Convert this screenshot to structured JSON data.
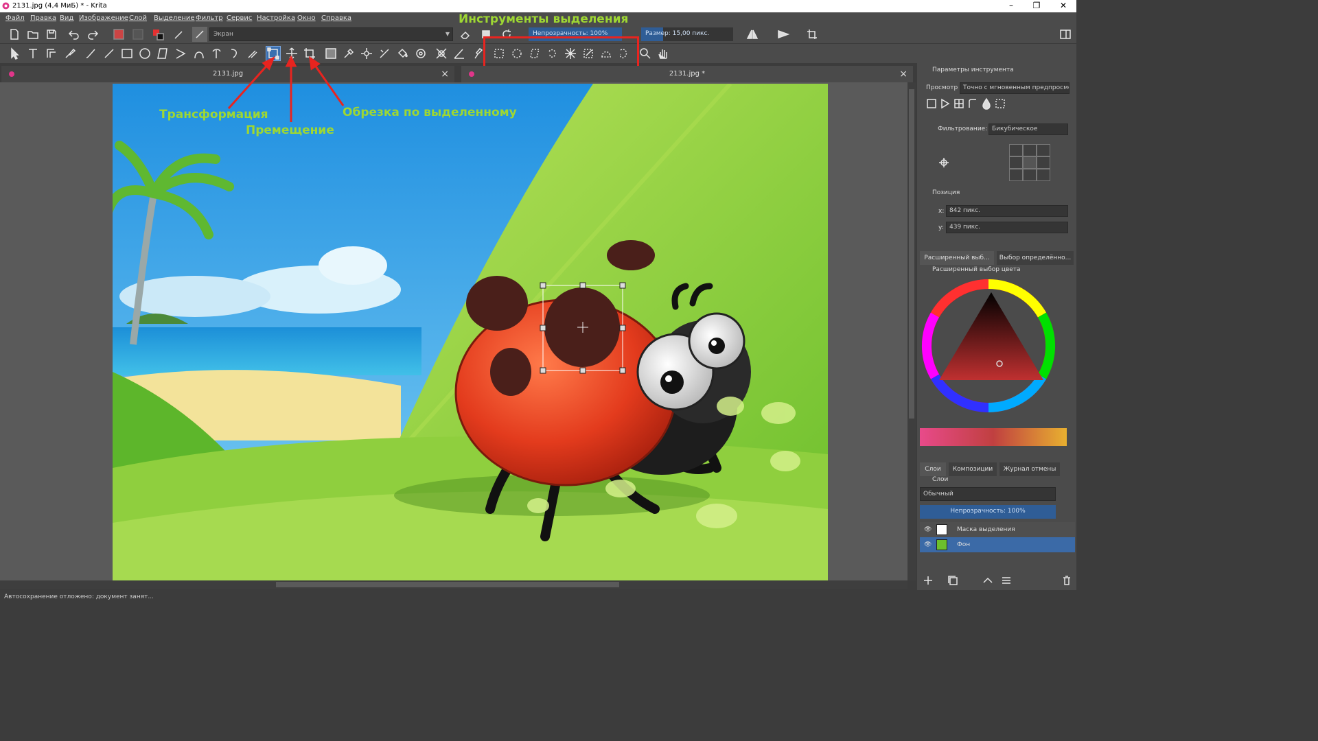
{
  "window": {
    "title": "2131.jpg (4,4 МиБ)  * - Krita",
    "minimize": "–",
    "maximize": "❐",
    "close": "✕"
  },
  "menu": [
    "Файл",
    "Правка",
    "Вид",
    "Изображение",
    "Слой",
    "Выделение",
    "Фильтр",
    "Сервис",
    "Настройка",
    "Окно",
    "Справка"
  ],
  "toolbar": {
    "blend_mode": "Экран",
    "opacity": "Непрозрачность: 100%",
    "size": "Размер: 15,00 пикс."
  },
  "tabs": [
    {
      "label": "2131.jpg"
    },
    {
      "label": "2131.jpg *"
    }
  ],
  "annotations": {
    "selection_tools": "Инструменты выделения",
    "transform": "Трансформация",
    "move": "Премещение",
    "crop": "Обрезка по выделенному"
  },
  "tool_options": {
    "title": "Параметры инструмента",
    "preview_label": "Просмотр",
    "preview_value": "Точно с мгновенным предпросмотром",
    "filter_label": "Фильтрование:",
    "filter_value": "Бикубическое",
    "position_label": "Позиция",
    "x_label": "x:",
    "x_value": "842 пикс.",
    "y_label": "y:",
    "y_value": "439 пикс."
  },
  "color_panel": {
    "tab1": "Расширенный выб...",
    "tab2": "Выбор определённо...",
    "title": "Расширенный выбор цвета"
  },
  "layers_panel": {
    "tabs": [
      "Слои",
      "Композиции",
      "Журнал отмены"
    ],
    "title": "Слои",
    "blend": "Обычный",
    "opacity": "Непрозрачность:  100%",
    "layers": [
      {
        "name": "Маска выделения",
        "selected": false
      },
      {
        "name": "Фон",
        "selected": true
      }
    ]
  },
  "status": "Автосохранение отложено: документ занят..."
}
